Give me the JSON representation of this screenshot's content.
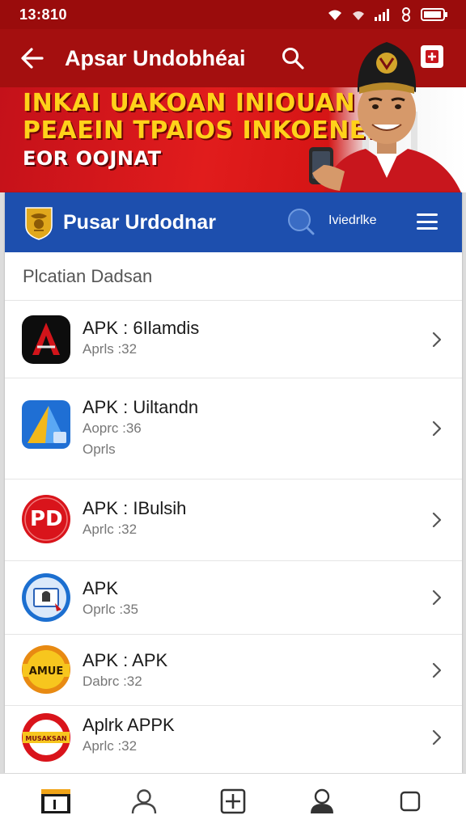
{
  "status_bar": {
    "time": "13:810"
  },
  "toolbar": {
    "title": "Apsar Undobhéai"
  },
  "banner": {
    "line1": "INKAI UAKOAN INIOUAN",
    "line2": "PEAEIN TPAIOS INKOENEIS",
    "line3": "EOR OOJNAT"
  },
  "card": {
    "title": "Pusar Urdodnar",
    "menu_label": "Iviedrlke",
    "section_title": "Plcatian Dadsan"
  },
  "apps": [
    {
      "name": "APK : 6Ilamdis",
      "meta1": "Aprls :32",
      "meta2": "",
      "icon": "red-a-app-icon"
    },
    {
      "name": "APK : Uiltandn",
      "meta1": "Aoprc :36",
      "meta2": "Oprls",
      "icon": "blue-a-app-icon"
    },
    {
      "name": "APK : IBulsih",
      "meta1": "Aprlc :32",
      "meta2": "",
      "icon": "pd-app-icon"
    },
    {
      "name": "APK",
      "meta1": "Oprlc :35",
      "meta2": "",
      "icon": "document-app-icon"
    },
    {
      "name": "APK : APK",
      "meta1": "Dabrc :32",
      "meta2": "",
      "icon": "yellow-badge-app-icon"
    },
    {
      "name": "Aplrk APPK",
      "meta1": "Aprlc :32",
      "meta2": "",
      "icon": "red-yellow-badge-app-icon"
    }
  ],
  "colors": {
    "toolbar": "#a40f0f",
    "status_bar": "#9a0c0c",
    "card_header": "#1d4fae",
    "banner_text": "#ffd21a"
  },
  "bottom_nav": [
    "home-icon",
    "profile-icon",
    "add-icon",
    "account-icon",
    "tabs-icon"
  ]
}
